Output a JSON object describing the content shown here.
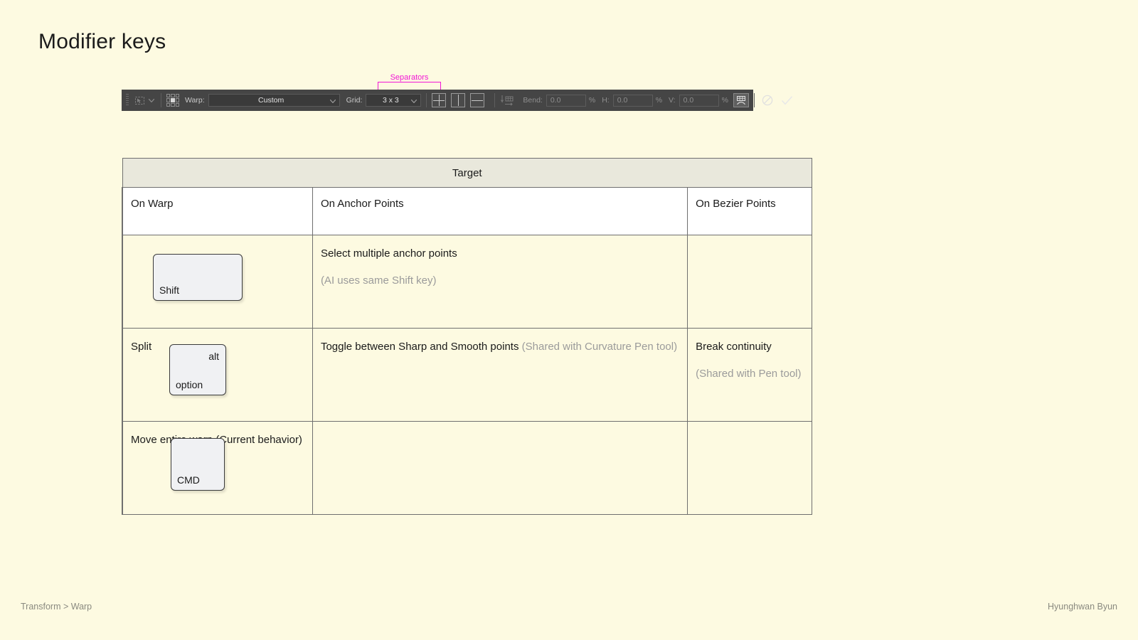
{
  "page": {
    "title": "Modifier keys",
    "background_color": "#FDFAE1"
  },
  "toolbar": {
    "selection_icon": "marquee-selection-icon",
    "reference_point_icon": "reference-point-grid-icon",
    "warp_label": "Warp:",
    "warp_value": "Custom",
    "grid_label": "Grid:",
    "grid_value": "3 x 3",
    "separator_buttons": [
      {
        "name": "split-both-button",
        "mode": "both"
      },
      {
        "name": "split-vertical-button",
        "mode": "vert"
      },
      {
        "name": "split-horizontal-button",
        "mode": "horz"
      }
    ],
    "warp_orientation_icon": "warp-orientation-icon",
    "bend_label": "Bend:",
    "bend_value": "0.0",
    "bend_unit": "%",
    "h_label": "H:",
    "h_value": "0.0",
    "h_unit": "%",
    "v_label": "V:",
    "v_value": "0.0",
    "v_unit": "%",
    "warp_toggle_icon": "warp-toggle-icon",
    "cancel_icon": "cancel-icon",
    "commit_icon": "commit-checkmark-icon"
  },
  "annotation": {
    "separators_label": "Separators",
    "color": "#F215D6"
  },
  "table": {
    "target_header": "Target",
    "columns": [
      {
        "label": "On Warp"
      },
      {
        "label": "On Anchor Points"
      },
      {
        "label": "On Bezier Points"
      }
    ],
    "rows": [
      {
        "key": {
          "name": "shift",
          "label_bottom_left": "Shift",
          "label_top_right": ""
        },
        "cells": [
          {
            "main": "",
            "note": ""
          },
          {
            "main": "Select multiple anchor points",
            "note": "(AI uses same Shift key)"
          },
          {
            "main": "",
            "note": ""
          }
        ]
      },
      {
        "key": {
          "name": "alt-option",
          "label_bottom_left": "option",
          "label_top_right": "alt"
        },
        "cells": [
          {
            "main": "Split",
            "note": ""
          },
          {
            "main": "Toggle between Sharp and Smooth points",
            "note": "(Shared with Curvature Pen tool)"
          },
          {
            "main": "Break continuity",
            "note": "(Shared with Pen tool)"
          }
        ]
      },
      {
        "key": {
          "name": "cmd",
          "label_bottom_left": "CMD",
          "label_top_right": ""
        },
        "cells": [
          {
            "main": "Move entire warp (Current behavior)",
            "note": ""
          },
          {
            "main": "",
            "note": ""
          },
          {
            "main": "",
            "note": ""
          }
        ]
      }
    ]
  },
  "footer": {
    "left": "Transform > Warp",
    "right": "Hyunghwan Byun"
  }
}
